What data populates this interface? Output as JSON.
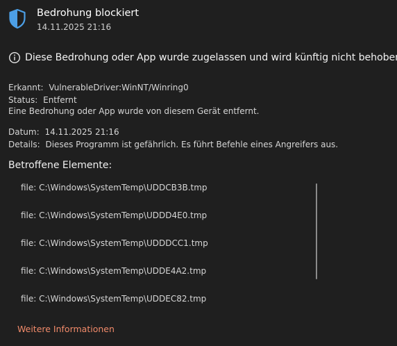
{
  "header": {
    "title": "Bedrohung blockiert",
    "timestamp": "14.11.2025 21:16",
    "icon": "shield-icon",
    "accent_color": "#4c9fe6"
  },
  "notice": {
    "icon": "info-icon",
    "text": "Diese Bedrohung oder App wurde zugelassen und wird künftig nicht behoben."
  },
  "details": {
    "erkannt_label": "Erkannt:",
    "erkannt_value": "VulnerableDriver:WinNT/Winring0",
    "status_label": "Status:",
    "status_value": "Entfernt",
    "removed_note": "Eine Bedrohung oder App wurde von diesem Gerät entfernt.",
    "datum_label": "Datum:",
    "datum_value": "14.11.2025 21:16",
    "details_label": "Details:",
    "details_value": "Dieses Programm ist gefährlich. Es führt Befehle eines Angreifers aus."
  },
  "affected": {
    "title": "Betroffene Elemente:",
    "items": [
      "file: C:\\Windows\\SystemTemp\\UDDCB3B.tmp",
      "file: C:\\Windows\\SystemTemp\\UDDD4E0.tmp",
      "file: C:\\Windows\\SystemTemp\\UDDDCC1.tmp",
      "file: C:\\Windows\\SystemTemp\\UDDE4A2.tmp",
      "file: C:\\Windows\\SystemTemp\\UDDEC82.tmp"
    ]
  },
  "link": {
    "label": "Weitere Informationen",
    "color": "#f08a6a"
  }
}
